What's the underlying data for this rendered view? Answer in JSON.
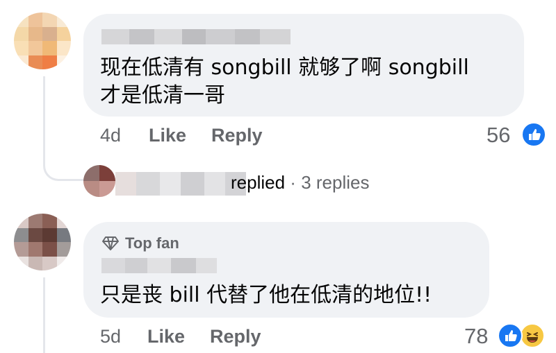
{
  "comments": [
    {
      "text_line1": "现在低清有 songbill 就够了啊 songbill",
      "text_line2": "才是低清一哥",
      "time": "4d",
      "like_label": "Like",
      "reply_label": "Reply",
      "reaction_count": "56",
      "reactions": [
        "like-icon"
      ]
    },
    {
      "badge": "Top fan",
      "badge_icon": "diamond-icon",
      "text": "只是丧 bill 代替了他在低清的地位!!",
      "time": "5d",
      "like_label": "Like",
      "reply_label": "Reply",
      "reaction_count": "78",
      "reactions": [
        "like-icon",
        "haha-icon"
      ]
    }
  ],
  "replies_summary": {
    "replied_label": "replied",
    "separator": "·",
    "replies_count": "3 replies"
  },
  "colors": {
    "bubble": "#f0f2f5",
    "meta_text": "#65676b",
    "like_blue": "#1877f2"
  }
}
